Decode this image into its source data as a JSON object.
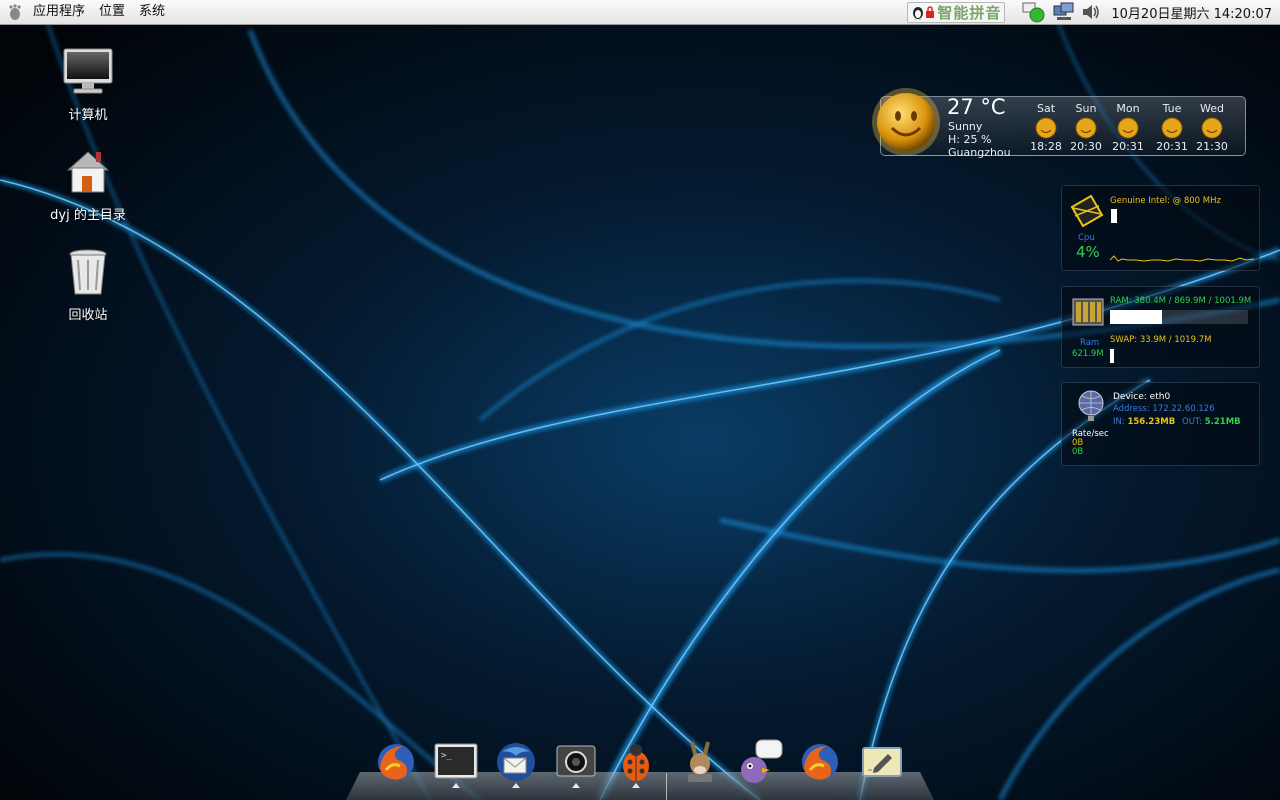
{
  "top_panel": {
    "menus": [
      "应用程序",
      "位置",
      "系统"
    ],
    "ime_label": "智能拼音",
    "clock": "10月20日星期六 14:20:07",
    "tray_icons": [
      "network-icon",
      "display-icon",
      "volume-icon"
    ]
  },
  "desktop_icons": [
    {
      "label": "计算机",
      "icon": "computer-icon"
    },
    {
      "label": "dyj 的主目录",
      "icon": "home-folder-icon"
    },
    {
      "label": "回收站",
      "icon": "trash-icon"
    }
  ],
  "weather": {
    "temperature": "27 °C",
    "condition": "Sunny",
    "humidity": "H: 25 %",
    "city": "Guangzhou",
    "forecast": [
      {
        "day": "Sat",
        "time": "18:28"
      },
      {
        "day": "Sun",
        "time": "20:30"
      },
      {
        "day": "Mon",
        "time": "20:31"
      },
      {
        "day": "Tue",
        "time": "20:31"
      },
      {
        "day": "Wed",
        "time": "21:30"
      }
    ]
  },
  "cpu": {
    "model": "Genuine Intel: @ 800 MHz",
    "label": "Cpu",
    "usage": "4%",
    "usage_fraction": 0.04
  },
  "memory": {
    "ram": "RAM: 380.4M / 869.9M / 1001.9M",
    "ram_fraction": 0.38,
    "swap": "SWAP: 33.9M / 1019.7M",
    "swap_fraction": 0.03,
    "label": "Ram",
    "value": "621.9M"
  },
  "network": {
    "device": "Device: eth0",
    "address": "Address: 172.22.60.126",
    "in_label": "IN:",
    "in_value": "156.23MB",
    "out_label": "OUT:",
    "out_value": "5.21MB",
    "rate_label": "Rate/sec",
    "rate_in": "0B",
    "rate_out": "0B"
  },
  "dock": {
    "items": [
      "firefox-icon",
      "terminal-icon",
      "thunderbird-icon",
      "screenshot-icon",
      "ladybug-icon",
      "amule-donkey-icon",
      "pidgin-icon",
      "firefox-icon",
      "text-editor-icon"
    ]
  },
  "colors": {
    "panel_bg": "#ececec",
    "conky_green": "#2fd14a",
    "conky_yellow": "#e8c416",
    "wallpaper_glow": "#1aa3ff"
  }
}
